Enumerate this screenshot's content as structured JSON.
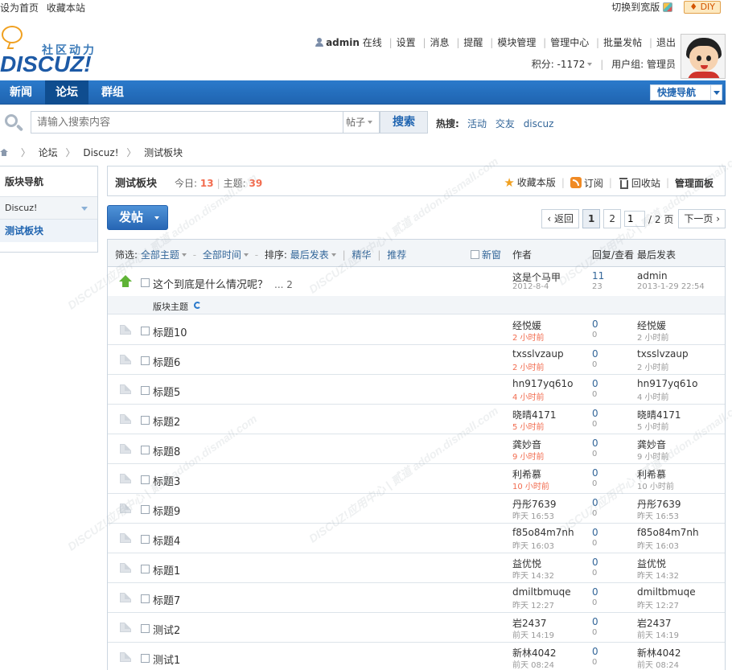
{
  "topbar": {
    "set_home": "设为首页",
    "bookmark_site": "收藏本站",
    "switch_wide": "切换到宽版",
    "diy": "DIY"
  },
  "logo": {
    "slogan": "社区动力",
    "wordmark": "DISCUZ!"
  },
  "user": {
    "name": "admin",
    "status": "在线",
    "links": [
      "设置",
      "消息",
      "提醒",
      "模块管理",
      "管理中心",
      "批量发帖",
      "退出"
    ],
    "credits_label": "积分: -1172",
    "group_label": "用户组: 管理员"
  },
  "nav": {
    "items": [
      "新闻",
      "论坛",
      "群组"
    ],
    "active": "论坛",
    "quick_nav": "快捷导航"
  },
  "search": {
    "placeholder": "请输入搜索内容",
    "type": "帖子",
    "button": "搜索",
    "hot_label": "热搜:",
    "hot_links": [
      "活动",
      "交友",
      "discuz"
    ]
  },
  "breadcrumb": [
    "论坛",
    "Discuz!",
    "测试板块"
  ],
  "sidebar": {
    "title": "版块导航",
    "category": "Discuz!",
    "forum": "测试板块"
  },
  "forum": {
    "name": "测试板块",
    "today_label": "今日:",
    "today": "13",
    "topics_label": "主题:",
    "topics": "39",
    "favorite": "收藏本版",
    "subscribe": "订阅",
    "recycle": "回收站",
    "manage": "管理面板"
  },
  "post_button": "发帖",
  "pager": {
    "prev": "返回",
    "pages": [
      "1",
      "2"
    ],
    "current": "1",
    "input_value": "1",
    "total": "/ 2 页",
    "next": "下一页"
  },
  "list_header": {
    "filter_label": "筛选:",
    "all_topics": "全部主题",
    "all_time": "全部时间",
    "sort_label": "排序:",
    "sort_value": "最后发表",
    "digest": "精华",
    "recommend": "推荐",
    "new_window": "新窗",
    "col_author": "作者",
    "col_replies": "回复/查看",
    "col_last": "最后发表"
  },
  "sticky": {
    "title": "这个到底是什么情况呢？",
    "pages": "... 2",
    "author": "这是个马甲",
    "date": "2012-8-4",
    "replies": "11",
    "views": "23",
    "last_author": "admin",
    "last_date": "2013-1-29 22:54"
  },
  "section_label": "版块主题",
  "threads": [
    {
      "title": "标题10",
      "author": "经悦媛",
      "date": "2 小时前",
      "hot": true,
      "replies": "0",
      "views": "0",
      "last_author": "经悦媛",
      "last_date": "2 小时前"
    },
    {
      "title": "标题6",
      "author": "txsslvzaup",
      "date": "2 小时前",
      "hot": true,
      "replies": "0",
      "views": "0",
      "last_author": "txsslvzaup",
      "last_date": "2 小时前"
    },
    {
      "title": "标题5",
      "author": "hn917yq61o",
      "date": "4 小时前",
      "hot": true,
      "replies": "0",
      "views": "0",
      "last_author": "hn917yq61o",
      "last_date": "4 小时前"
    },
    {
      "title": "标题2",
      "author": "晓晴4171",
      "date": "5 小时前",
      "hot": true,
      "replies": "0",
      "views": "0",
      "last_author": "晓晴4171",
      "last_date": "5 小时前"
    },
    {
      "title": "标题8",
      "author": "龚妙音",
      "date": "9 小时前",
      "hot": true,
      "replies": "0",
      "views": "0",
      "last_author": "龚妙音",
      "last_date": "9 小时前"
    },
    {
      "title": "标题3",
      "author": "利希慕",
      "date": "10 小时前",
      "hot": true,
      "replies": "0",
      "views": "0",
      "last_author": "利希慕",
      "last_date": "10 小时前"
    },
    {
      "title": "标题9",
      "author": "丹彤7639",
      "date": "昨天 16:53",
      "hot": false,
      "replies": "0",
      "views": "0",
      "last_author": "丹彤7639",
      "last_date": "昨天 16:53"
    },
    {
      "title": "标题4",
      "author": "f85o84m7nh",
      "date": "昨天 16:03",
      "hot": false,
      "replies": "0",
      "views": "0",
      "last_author": "f85o84m7nh",
      "last_date": "昨天 16:03"
    },
    {
      "title": "标题1",
      "author": "益优悦",
      "date": "昨天 14:32",
      "hot": false,
      "replies": "0",
      "views": "0",
      "last_author": "益优悦",
      "last_date": "昨天 14:32"
    },
    {
      "title": "标题7",
      "author": "dmiltbmuqe",
      "date": "昨天 12:27",
      "hot": false,
      "replies": "0",
      "views": "0",
      "last_author": "dmiltbmuqe",
      "last_date": "昨天 12:27"
    },
    {
      "title": "测试2",
      "author": "岩2437",
      "date": "前天 14:19",
      "hot": false,
      "replies": "0",
      "views": "0",
      "last_author": "岩2437",
      "last_date": "前天 14:19"
    },
    {
      "title": "测试1",
      "author": "新林4042",
      "date": "前天 08:24",
      "hot": false,
      "replies": "0",
      "views": "0",
      "last_author": "新林4042",
      "last_date": "前天 08:24"
    }
  ],
  "watermark": "DISCUZ!应用中心 | 贰道 addon.dismall.com"
}
